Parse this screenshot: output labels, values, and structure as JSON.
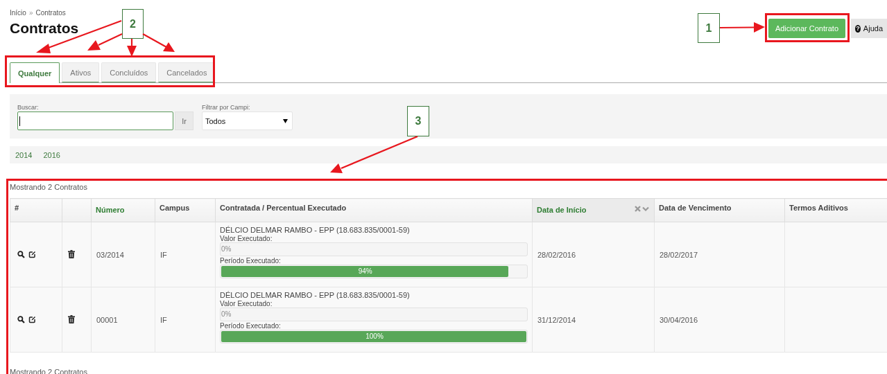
{
  "breadcrumb": {
    "items": [
      "Início",
      "Contratos"
    ],
    "separator": "»"
  },
  "title": "Contratos",
  "actions": {
    "primary": "Adicionar Contrato",
    "help": {
      "icon": "?",
      "label": "Ajuda"
    }
  },
  "tabs": [
    {
      "label": "Qualquer",
      "selected": true
    },
    {
      "label": "Ativos",
      "selected": false
    },
    {
      "label": "Concluídos",
      "selected": false
    },
    {
      "label": "Cancelados",
      "selected": false
    }
  ],
  "filters": {
    "search": {
      "label": "Buscar:",
      "focused": true,
      "button": "Ir"
    },
    "campus": {
      "label": "Filtrar por Campi:",
      "value": "Todos"
    }
  },
  "years": [
    "2014",
    "2016"
  ],
  "summary_top": "Mostrando 2 Contratos",
  "table": {
    "columns": [
      {
        "label": "#",
        "sortable": false,
        "sorted": false
      },
      {
        "label": "Número",
        "sortable": true,
        "sorted": false
      },
      {
        "label": "Campus",
        "sortable": false,
        "sorted": false
      },
      {
        "label": "Contratada / Percentual Executado",
        "sortable": false,
        "sorted": false
      },
      {
        "label": "Data de Início",
        "sortable": true,
        "sorted": true
      },
      {
        "label": "Data de Vencimento",
        "sortable": false,
        "sorted": false
      },
      {
        "label": "Termos Aditivos",
        "sortable": false,
        "sorted": false
      }
    ],
    "rows": [
      {
        "numero": "03/2014",
        "campus": "IF",
        "contratada": "DÉLCIO DELMAR RAMBO - EPP (18.683.835/0001-59)",
        "valor_label": "Valor Executado:",
        "valor": {
          "level": 0,
          "text": "0%"
        },
        "periodo_label": "Período Executado:",
        "periodo": {
          "level": 0.94,
          "text": "94%"
        },
        "inicio": "28/02/2016",
        "vencimento": "28/02/2017"
      },
      {
        "numero": "00001",
        "campus": "IF",
        "contratada": "DÉLCIO DELMAR RAMBO - EPP (18.683.835/0001-59)",
        "valor_label": "Valor Executado:",
        "valor": {
          "level": 0,
          "text": "0%"
        },
        "periodo_label": "Período Executado:",
        "periodo": {
          "level": 1,
          "text": "100%"
        },
        "inicio": "31/12/2014",
        "vencimento": "30/04/2016"
      }
    ]
  },
  "summary_bottom": "Mostrando 2 Contratos",
  "callouts": [
    "1",
    "2",
    "3"
  ]
}
